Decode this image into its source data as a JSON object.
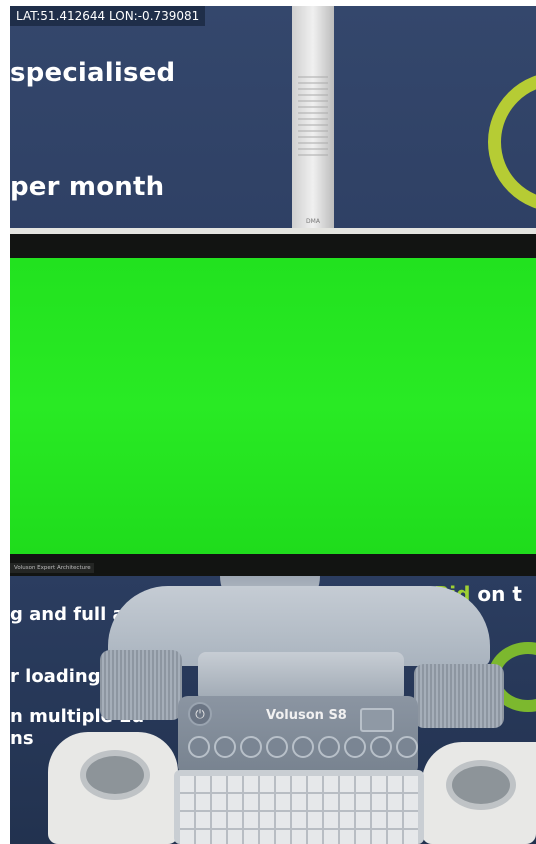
{
  "overlay": {
    "coordinates": "LAT:51.412644 LON:-0.739081"
  },
  "backdrop": {
    "line_1": "specialised",
    "line_2": "per month",
    "pole_label": "DMA"
  },
  "monitor": {
    "screen_color": "#26e623",
    "brand_strip": "Voluson Expert Architecture"
  },
  "lower_banner": {
    "line_1": "g and full aft",
    "line_2": "r loading",
    "line_3": "n multiple Eu",
    "line_4": "ns",
    "bid_word": "Bid",
    "bid_rest": "on t",
    "right_fragment": "on"
  },
  "console": {
    "model_label": "Voluson S8",
    "power_symbol": "⏻"
  },
  "colors": {
    "banner_navy": "#2e3f63",
    "accent_green": "#b6cc34",
    "screen_green": "#26e623"
  }
}
